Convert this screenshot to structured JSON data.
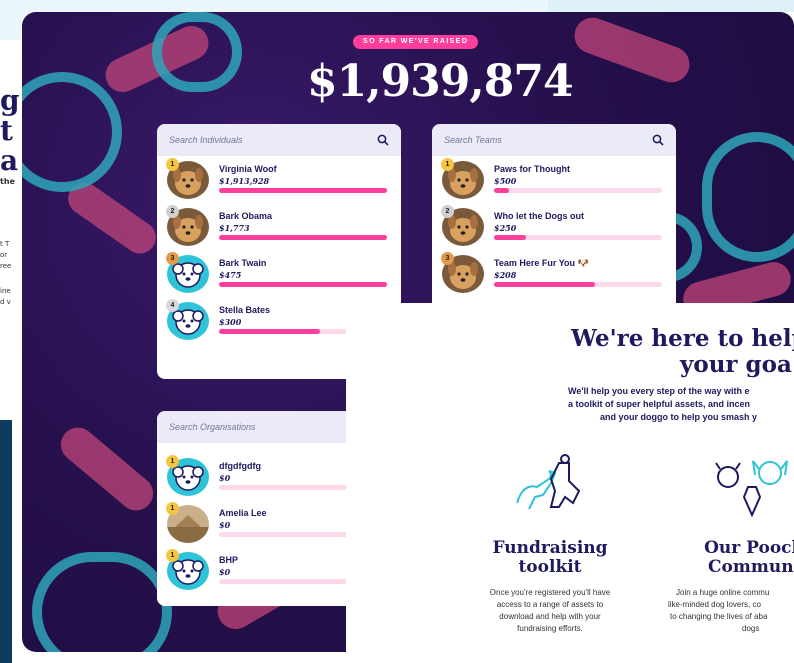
{
  "ghost": {
    "left_heading_1": "g",
    "left_heading_2": "t",
    "left_heading_3": "a",
    "left_text_1": "the",
    "left_text_2": "t T",
    "left_text_3": "or",
    "left_text_4": "ree",
    "left_text_5": "ine",
    "left_text_6": "d v"
  },
  "header": {
    "raised_label": "SO FAR WE'VE RAISED",
    "raised_amount": "$1,939,874"
  },
  "individuals": {
    "placeholder": "Search Individuals",
    "rows": [
      {
        "rank": "1",
        "name": "Virginia Woof",
        "amount": "$1,913,928",
        "progress": 1.0,
        "avatar": "dog-photo"
      },
      {
        "rank": "2",
        "name": "Bark Obama",
        "amount": "$1,773",
        "progress": 1.0,
        "avatar": "dog-photo"
      },
      {
        "rank": "3",
        "name": "Bark Twain",
        "amount": "$475",
        "progress": 1.0,
        "avatar": "dog-illustration"
      },
      {
        "rank": "4",
        "name": "Stella Bates",
        "amount": "$300",
        "progress": 0.6,
        "avatar": "dog-illustration"
      }
    ]
  },
  "teams": {
    "placeholder": "Search Teams",
    "rows": [
      {
        "rank": "1",
        "name": "Paws for Thought",
        "amount": "$500",
        "progress": 0.09,
        "avatar": "dog-photo"
      },
      {
        "rank": "2",
        "name": "Who let the Dogs out",
        "amount": "$250",
        "progress": 0.19,
        "avatar": "dog-photo"
      },
      {
        "rank": "3",
        "name": "Team Here Fur You 🐶",
        "amount": "$208",
        "progress": 0.6,
        "avatar": "dog-photo"
      }
    ]
  },
  "organisations": {
    "placeholder": "Search Organisations",
    "rows": [
      {
        "rank": "1",
        "name": "dfgdfgdfg",
        "amount": "$0",
        "progress": 0,
        "avatar": "dog-illustration"
      },
      {
        "rank": "1",
        "name": "Amelia Lee",
        "amount": "$0",
        "progress": 0,
        "avatar": "house-photo"
      },
      {
        "rank": "1",
        "name": "BHP",
        "amount": "$0",
        "progress": 0,
        "avatar": "dog-illustration"
      }
    ]
  },
  "overlay": {
    "heading_line1": "We're here to help",
    "heading_line2": "your goa",
    "sub_line1": "We'll help you every step of the way with e",
    "sub_line2": "a toolkit of super helpful assets, and incen",
    "sub_line3": "and your doggo to help you smash y",
    "features": [
      {
        "icon": "dog-and-person-icon",
        "title_line1": "Fundraising",
        "title_line2": "toolkit",
        "body_line1": "Once you're registered you'll have",
        "body_line2": "access to a range of assets to",
        "body_line3": "download and help with your",
        "body_line4": "fundraising efforts."
      },
      {
        "icon": "dog-faces-icon",
        "title_line1": "Our Pooch",
        "title_line2": "Communi",
        "body_line1": "Join a huge online commu",
        "body_line2": "like-minded dog lovers, co",
        "body_line3": "to changing the lives of aba",
        "body_line4": "dogs"
      }
    ]
  },
  "colors": {
    "brand_navy": "#1d1a5e",
    "accent_pink": "#ff3d9a",
    "accent_teal": "#2ea6b8",
    "gold_rank": "#f5c542",
    "silver_rank": "#cfcfd6",
    "bronze_rank": "#e09a4a"
  }
}
